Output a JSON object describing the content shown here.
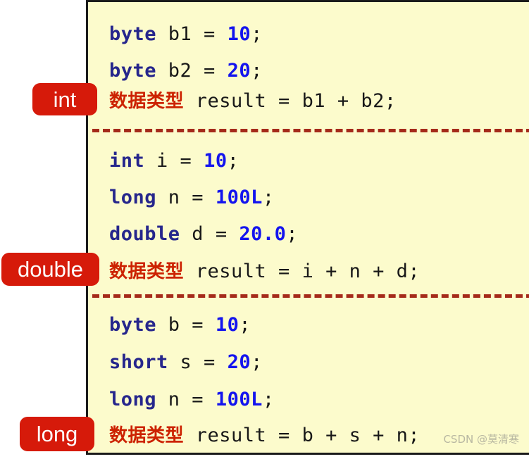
{
  "panel": {
    "background_color": "#fcfbcc",
    "border_color": "#1b1b1b",
    "separator_color": "#a52a1a"
  },
  "colors": {
    "badge_red": "#d61a0a",
    "keyword_blue": "#26268c",
    "literal_blue": "#1414ee",
    "chinese_red": "#cc2200",
    "watermark_gray": "#b9b8a2"
  },
  "badges": [
    {
      "id": "int",
      "label": "int"
    },
    {
      "id": "double",
      "label": "double"
    },
    {
      "id": "long",
      "label": "long"
    }
  ],
  "blocks": [
    {
      "result_type": "int",
      "lines": [
        {
          "keyword": "byte",
          "rest": " b1 = ",
          "literal": "10",
          "end": ";"
        },
        {
          "keyword": "byte",
          "rest": " b2 = ",
          "literal": "20",
          "end": ";"
        }
      ],
      "result_line": {
        "chinese": "数据类型",
        "rest": " result = b1 + b2;"
      }
    },
    {
      "result_type": "double",
      "lines": [
        {
          "keyword": "int",
          "rest": " i = ",
          "literal": "10",
          "end": ";"
        },
        {
          "keyword": "long",
          "rest": " n = ",
          "literal": "100L",
          "end": ";"
        },
        {
          "keyword": "double",
          "rest": " d = ",
          "literal": "20.0",
          "end": ";"
        }
      ],
      "result_line": {
        "chinese": "数据类型",
        "rest": " result = i + n + d;"
      }
    },
    {
      "result_type": "long",
      "lines": [
        {
          "keyword": "byte",
          "rest": " b = ",
          "literal": "10",
          "end": ";"
        },
        {
          "keyword": "short",
          "rest": " s = ",
          "literal": "20",
          "end": ";"
        },
        {
          "keyword": "long",
          "rest": " n = ",
          "literal": "100L",
          "end": ";"
        }
      ],
      "result_line": {
        "chinese": "数据类型",
        "rest": " result = b + s + n;"
      }
    }
  ],
  "code_text": {
    "l1_kw": "byte",
    "l1_rest": " b1 = ",
    "l1_num": "10",
    "l1_end": ";",
    "l2_kw": "byte",
    "l2_rest": " b2 = ",
    "l2_num": "20",
    "l2_end": ";",
    "l3_cn": "数据类型",
    "l3_rest": " result = b1 + b2;",
    "l4_kw": "int",
    "l4_rest": " i = ",
    "l4_num": "10",
    "l4_end": ";",
    "l5_kw": "long",
    "l5_rest": " n = ",
    "l5_num": "100L",
    "l5_end": ";",
    "l6_kw": "double",
    "l6_rest": " d = ",
    "l6_num": "20.0",
    "l6_end": ";",
    "l7_cn": "数据类型",
    "l7_rest": " result = i + n + d;",
    "l8_kw": "byte",
    "l8_rest": " b = ",
    "l8_num": "10",
    "l8_end": ";",
    "l9_kw": "short",
    "l9_rest": " s = ",
    "l9_num": "20",
    "l9_end": ";",
    "l10_kw": "long",
    "l10_rest": " n = ",
    "l10_num": "100L",
    "l10_end": ";",
    "l11_cn": "数据类型",
    "l11_rest": " result = b + s + n;"
  },
  "watermark": {
    "text": "CSDN @莫清寒"
  }
}
